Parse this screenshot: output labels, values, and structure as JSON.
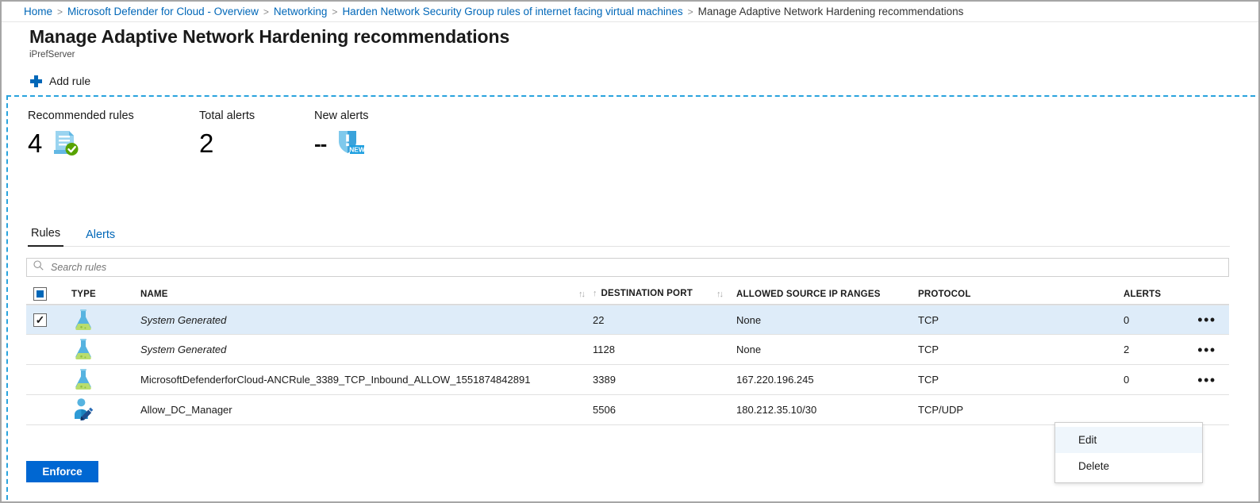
{
  "breadcrumb": {
    "separator": ">",
    "items": [
      {
        "label": "Home",
        "current": false
      },
      {
        "label": "Microsoft Defender for Cloud - Overview",
        "current": false
      },
      {
        "label": "Networking",
        "current": false
      },
      {
        "label": "Harden Network Security Group rules of internet facing virtual machines",
        "current": false
      },
      {
        "label": "Manage Adaptive Network Hardening recommendations",
        "current": true
      }
    ]
  },
  "header": {
    "title": "Manage Adaptive Network Hardening recommendations",
    "subtitle": "iPrefServer"
  },
  "command_bar": {
    "add_rule_label": "Add rule",
    "add_rule_icon": "plus-icon",
    "accent_color": "#0067b8"
  },
  "stats": [
    {
      "label": "Recommended rules",
      "value": "4",
      "icon": "document-check-icon"
    },
    {
      "label": "Total alerts",
      "value": "2",
      "icon": "none"
    },
    {
      "label": "New alerts",
      "value": "--",
      "icon": "shield-new-alert-icon",
      "badge": "NEW"
    }
  ],
  "tabs": [
    {
      "label": "Rules",
      "active": true
    },
    {
      "label": "Alerts",
      "active": false
    }
  ],
  "search": {
    "placeholder": "Search rules",
    "value": "",
    "icon": "search-icon"
  },
  "table": {
    "columns": [
      {
        "key": "check",
        "label": "",
        "sortable": false
      },
      {
        "key": "type",
        "label": "TYPE",
        "sortable": false
      },
      {
        "key": "name",
        "label": "NAME",
        "sortable": true,
        "sort_glyph": "↑↓"
      },
      {
        "key": "port",
        "label": "DESTINATION PORT",
        "sortable": true,
        "sort_glyph": "↑↓",
        "lead_glyph": "↑"
      },
      {
        "key": "ips",
        "label": "ALLOWED SOURCE IP RANGES",
        "sortable": false
      },
      {
        "key": "protocol",
        "label": "PROTOCOL",
        "sortable": false
      },
      {
        "key": "alerts",
        "label": "ALERTS",
        "sortable": false
      }
    ],
    "select_all_state": "indeterminate",
    "rows": [
      {
        "checked": true,
        "selected": true,
        "type_icon": "flask-icon",
        "name": "System Generated",
        "name_italic": true,
        "port": "22",
        "ips": "None",
        "protocol": "TCP",
        "alerts": "0",
        "menu_glyph": "•••"
      },
      {
        "checked": false,
        "selected": false,
        "type_icon": "flask-icon",
        "name": "System Generated",
        "name_italic": true,
        "port": "1128",
        "ips": "None",
        "protocol": "TCP",
        "alerts": "2",
        "menu_glyph": "•••"
      },
      {
        "checked": false,
        "selected": false,
        "type_icon": "flask-icon",
        "name": "MicrosoftDefenderforCloud-ANCRule_3389_TCP_Inbound_ALLOW_1551874842891",
        "name_italic": false,
        "port": "3389",
        "ips": "167.220.196.245",
        "protocol": "TCP",
        "alerts": "0",
        "menu_glyph": "•••"
      },
      {
        "checked": false,
        "selected": false,
        "type_icon": "user-edit-icon",
        "name": "Allow_DC_Manager",
        "name_italic": false,
        "port": "5506",
        "ips": "180.212.35.10/30",
        "protocol": "TCP/UDP",
        "alerts": "",
        "menu_glyph": ""
      }
    ]
  },
  "context_menu": {
    "items": [
      {
        "label": "Edit",
        "hovered": true
      },
      {
        "label": "Delete",
        "hovered": false
      }
    ]
  },
  "footer": {
    "enforce_label": "Enforce",
    "enforce_color": "#0067d2"
  }
}
